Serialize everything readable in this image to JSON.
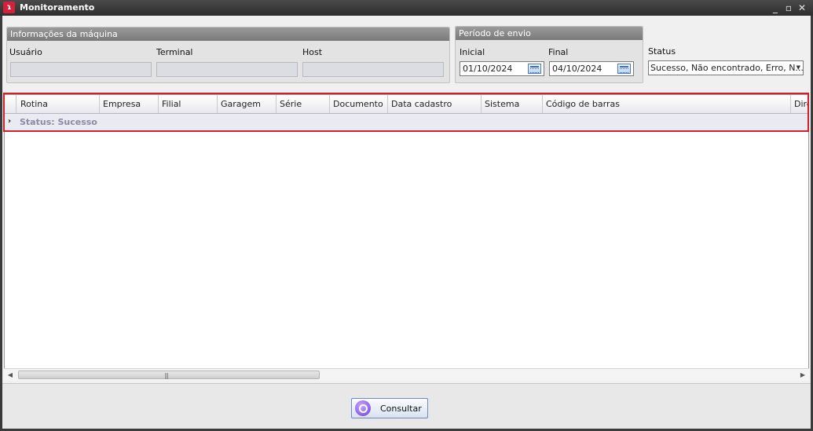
{
  "window": {
    "title": "Monitoramento",
    "logo": "ɿ",
    "minimize": "_",
    "maximize": "▫",
    "close": "✕"
  },
  "machine_info": {
    "header": "Informações da máquina",
    "user_label": "Usuário",
    "terminal_label": "Terminal",
    "host_label": "Host"
  },
  "period": {
    "header": "Período de envio",
    "initial_label": "Inicial",
    "initial_value": "01/10/2024",
    "final_label": "Final",
    "final_value": "04/10/2024"
  },
  "status": {
    "label": "Status",
    "value": "Sucesso, Não encontrado, Erro, N...",
    "arrow": "▼"
  },
  "grid": {
    "columns": [
      "Rotina",
      "Empresa",
      "Filial",
      "Garagem",
      "Série",
      "Documento",
      "Data cadastro",
      "Sistema",
      "Código de barras",
      "Dire"
    ],
    "group_row": "Status: Sucesso",
    "row_arrow": "›"
  },
  "scroll": {
    "left": "◀",
    "right": "▶",
    "grip": "|||"
  },
  "footer": {
    "consultar_label": "Consultar"
  }
}
